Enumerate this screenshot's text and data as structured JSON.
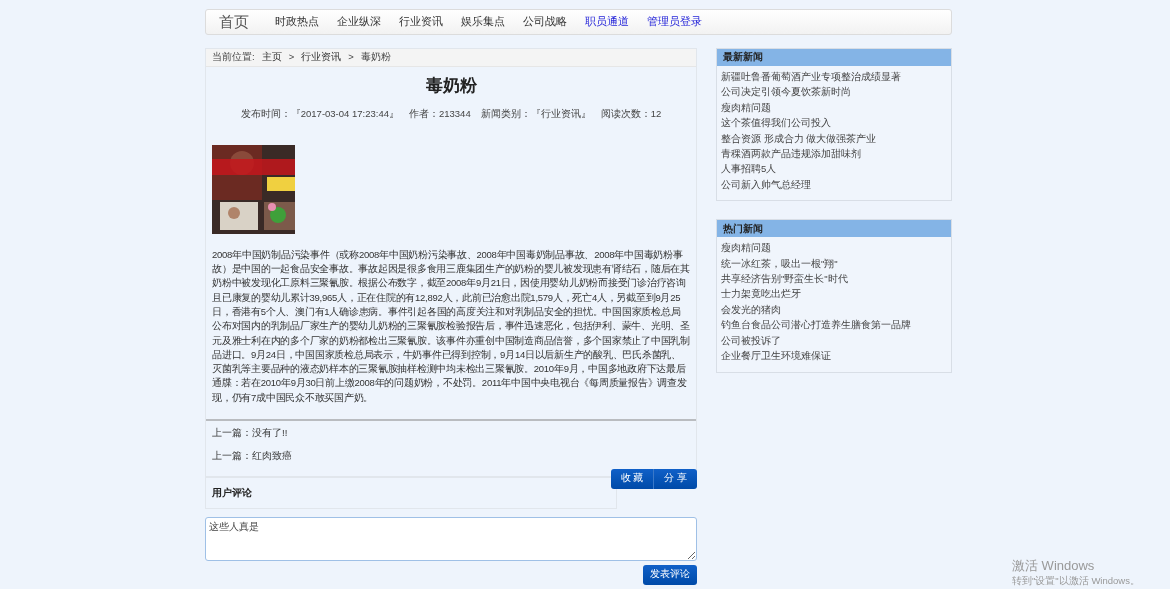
{
  "nav": {
    "home": "首页",
    "items": [
      {
        "label": "时政热点",
        "kind": "plain"
      },
      {
        "label": "企业纵深",
        "kind": "plain"
      },
      {
        "label": "行业资讯",
        "kind": "plain"
      },
      {
        "label": "娱乐集点",
        "kind": "plain"
      },
      {
        "label": "公司战略",
        "kind": "plain"
      },
      {
        "label": "职员通道",
        "kind": "link"
      },
      {
        "label": "管理员登录",
        "kind": "link"
      }
    ]
  },
  "breadcrumb": {
    "label": "当前位置:",
    "items": [
      "主页",
      "行业资讯",
      "毒奶粉"
    ],
    "separator": ">"
  },
  "article": {
    "title": "毒奶粉",
    "meta": [
      "发布时间：『2017-03-04 17:23:44』",
      "作者：213344",
      "新闻类别：『行业资讯』",
      "阅读次数：12"
    ],
    "body": "2008年中国奶制品污染事件（或称2008年中国奶粉污染事故、2008年中国毒奶制品事故、2008年中国毒奶粉事故）是中国的一起食品安全事故。事故起因是很多食用三鹿集团生产的奶粉的婴儿被发现患有肾结石，随后在其奶粉中被发现化工原料三聚氰胺。根据公布数字，截至2008年9月21日，因使用婴幼儿奶粉而接受门诊治疗咨询且已康复的婴幼儿累计39,965人，正在住院的有12,892人，此前已治愈出院1,579人，死亡4人，另截至到9月25日，香港有5个人、澳门有1人确诊患病。事件引起各国的高度关注和对乳制品安全的担忧。中国国家质检总局公布对国内的乳制品厂家生产的婴幼儿奶粉的三聚氰胺检验报告后，事件迅速恶化，包括伊利、蒙牛、光明、圣元及雅士利在内的多个厂家的奶粉都检出三聚氰胺。该事件亦重创中国制造商品信誉，多个国家禁止了中国乳制品进口。9月24日，中国国家质检总局表示，牛奶事件已得到控制，9月14日以后新生产的酸乳、巴氏杀菌乳、灭菌乳等主要品种的液态奶样本的三聚氰胺抽样检测中均未检出三聚氰胺。2010年9月，中国多地政府下达最后通牒：若在2010年9月30日前上缴2008年的问题奶粉，不处罚。2011年中国中央电视台《每周质量报告》调查发现，仍有7成中国民众不敢买国产奶。"
  },
  "adjacent": [
    "上一篇：没有了!!",
    "上一篇：红肉致癌"
  ],
  "actions": [
    "收 藏",
    "分 享"
  ],
  "comments": {
    "title": "用户评论",
    "input_value": "这些人真是",
    "submit": "发表评论"
  },
  "sidebar": [
    {
      "title": "最新新闻",
      "items": [
        "新疆吐鲁番葡萄酒产业专项整治成绩显著",
        "公司决定引领今夏饮茶新时尚",
        "瘦肉精问题",
        "这个茶值得我们公司投入",
        "整合资源 形成合力 做大做强茶产业",
        "青稞酒两款产品违规添加甜味剂",
        "人事招聘5人",
        "公司新入帅气总经理"
      ]
    },
    {
      "title": "热门新闻",
      "items": [
        "瘦肉精问题",
        "统一冰红茶，吸出一根\"翔\"",
        "共享经济告别\"野蛮生长\"时代",
        "士力架竟吃出烂牙",
        "会发光的猪肉",
        "钓鱼台食品公司潜心打造养生膳食第一品牌",
        "公司被投诉了",
        "企业餐厅卫生环境难保证"
      ]
    }
  ],
  "activation": {
    "title": "激活 Windows",
    "hint": "转到\"设置\"以激活 Windows。"
  }
}
